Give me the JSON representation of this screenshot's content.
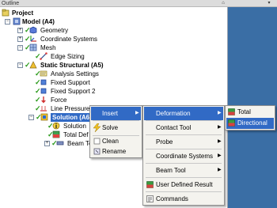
{
  "window": {
    "title": "Outline",
    "pin": "⌂",
    "dropdown": "▾"
  },
  "tree": {
    "project": "Project",
    "model": "Model (A4)",
    "geometry": "Geometry",
    "coordinate_systems": "Coordinate Systems",
    "mesh": "Mesh",
    "edge_sizing": "Edge Sizing",
    "static_structural": "Static Structural (A5)",
    "analysis_settings": "Analysis Settings",
    "fixed_support": "Fixed Support",
    "fixed_support_2": "Fixed Support 2",
    "force": "Force",
    "line_pressure": "Line Pressure",
    "solution": "Solution (A6)",
    "solution_info": "Solution",
    "total_def": "Total Def",
    "beam_tool": "Beam To"
  },
  "context_menu": {
    "insert": "Insert",
    "solve": "Solve",
    "clean": "Clean",
    "rename": "Rename"
  },
  "insert_menu": {
    "deformation": "Deformation",
    "contact_tool": "Contact Tool",
    "probe": "Probe",
    "coordinate_systems": "Coordinate Systems",
    "beam_tool": "Beam Tool",
    "user_defined_result": "User Defined Result",
    "commands": "Commands"
  },
  "deformation_menu": {
    "total": "Total",
    "directional": "Directional"
  },
  "colors": {
    "selection": "#316ac5",
    "menu_bg": "#f4f3ee",
    "desktop": "#3a6ea5"
  }
}
